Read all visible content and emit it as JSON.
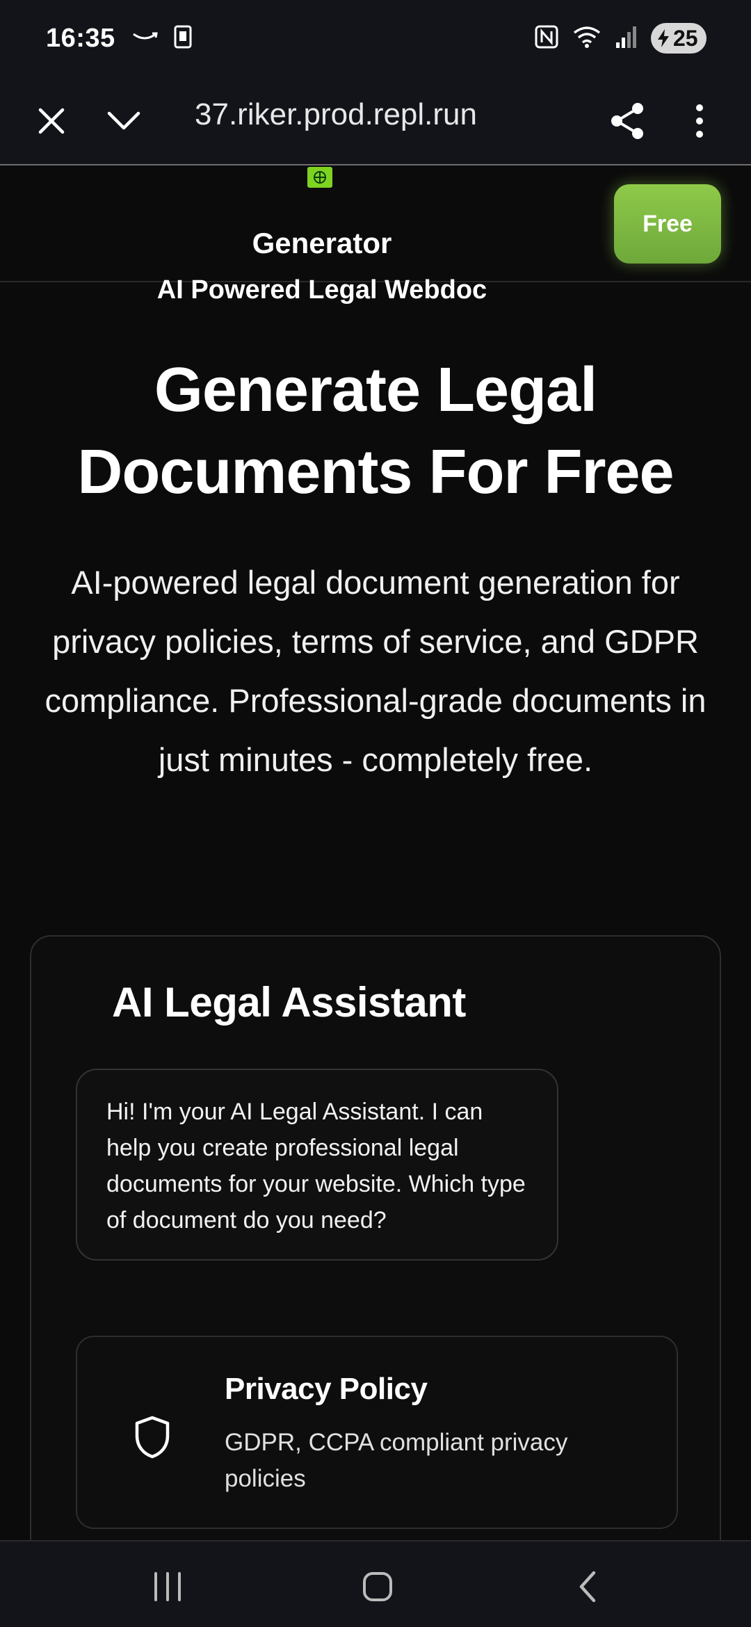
{
  "status_bar": {
    "time": "16:35",
    "battery": "25",
    "icons": [
      "amazon-icon",
      "kindle-icon",
      "nfc-icon",
      "wifi-icon",
      "signal-icon",
      "battery-icon"
    ]
  },
  "browser": {
    "url": "37.riker.prod.repl.run",
    "close_icon": "close-icon",
    "collapse_icon": "chevron-down-icon",
    "share_icon": "share-icon",
    "menu_icon": "more-vertical-icon"
  },
  "header": {
    "brand_line1": "Generator",
    "brand_line2": "AI Powered Legal Webdoc",
    "free_label": "Free",
    "accent": "#7ed321"
  },
  "hero": {
    "title": "Generate Legal Documents For Free",
    "subtitle": "AI-powered legal document generation for privacy policies, terms of service, and GDPR compliance. Professional-grade documents in just minutes - completely free."
  },
  "assistant": {
    "title": "AI Legal Assistant",
    "message": "Hi! I'm your AI Legal Assistant. I can help you create professional legal documents for your website. Which type of document do you need?",
    "options": [
      {
        "icon": "shield-icon",
        "title": "Privacy Policy",
        "description": "GDPR, CCPA compliant privacy policies"
      }
    ]
  },
  "nav": {
    "recents_icon": "recents-icon",
    "home_icon": "home-icon",
    "back_icon": "back-icon"
  }
}
